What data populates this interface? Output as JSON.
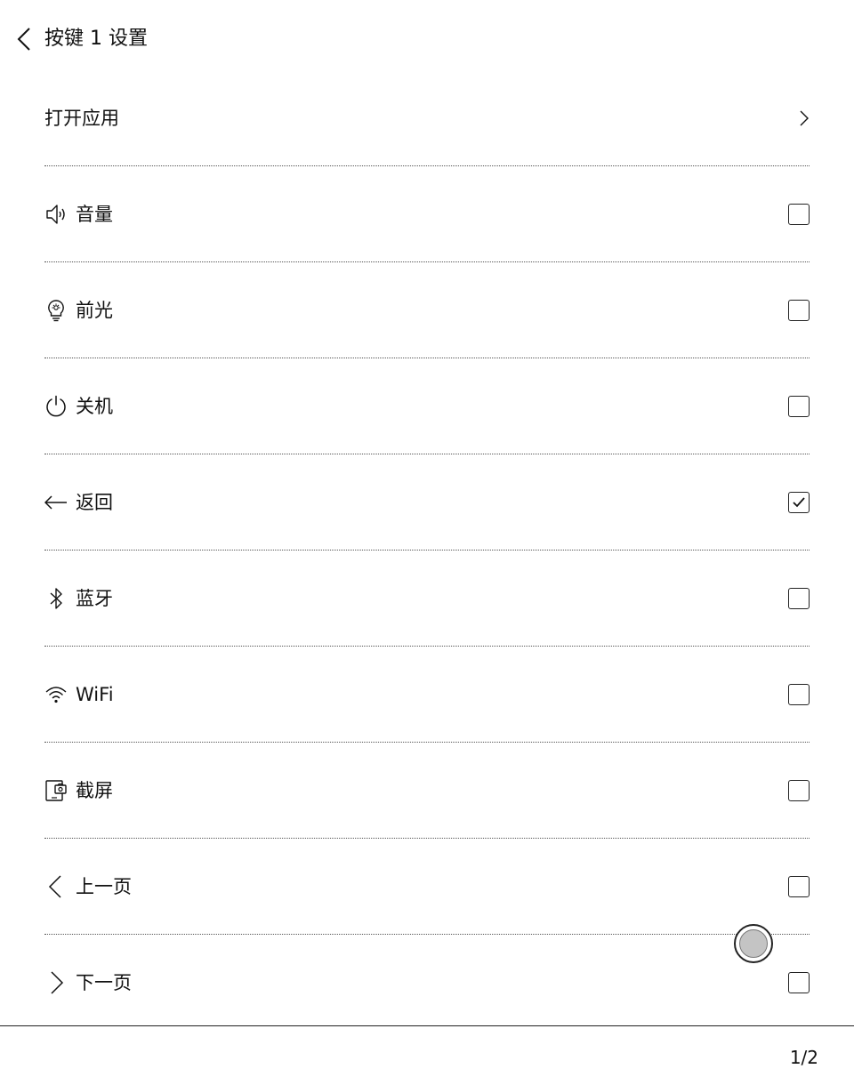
{
  "header": {
    "title": "按键 1 设置",
    "back_icon": "chevron-left-icon"
  },
  "items": [
    {
      "label": "打开应用",
      "icon": "",
      "control": "chevron-right-icon"
    },
    {
      "label": "音量",
      "icon": "speaker-icon",
      "checked": false
    },
    {
      "label": "前光",
      "icon": "lightbulb-icon",
      "checked": false
    },
    {
      "label": "关机",
      "icon": "power-icon",
      "checked": false
    },
    {
      "label": "返回",
      "icon": "arrow-left-icon",
      "checked": true
    },
    {
      "label": "蓝牙",
      "icon": "bluetooth-icon",
      "checked": false
    },
    {
      "label": "WiFi",
      "icon": "wifi-icon",
      "checked": false
    },
    {
      "label": "截屏",
      "icon": "screenshot-icon",
      "checked": false
    },
    {
      "label": "上一页",
      "icon": "chevron-left-icon",
      "checked": false
    },
    {
      "label": "下一页",
      "icon": "chevron-right-icon",
      "checked": false
    }
  ],
  "footer": {
    "page_indicator": "1/2"
  }
}
